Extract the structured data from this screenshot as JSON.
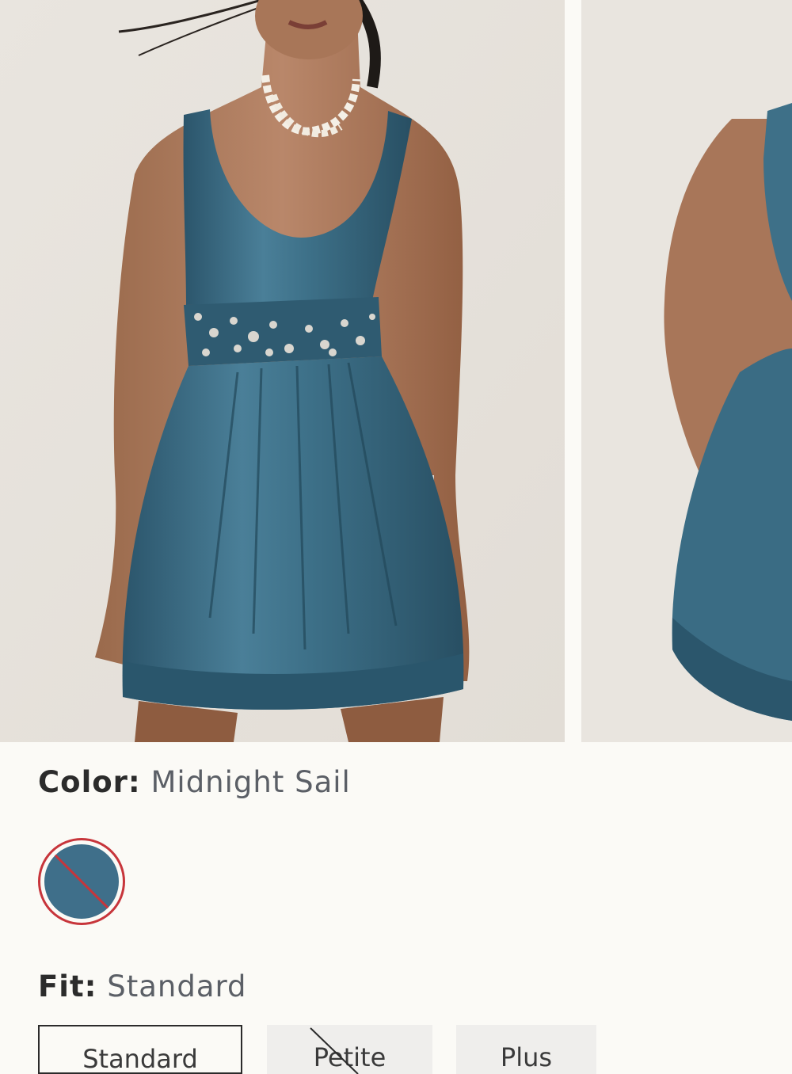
{
  "gallery": {
    "images": [
      {
        "alt": "Model wearing blue satin mini dress with embellished waistband, front view"
      },
      {
        "alt": "Model wearing blue satin mini dress, back view"
      }
    ]
  },
  "color": {
    "label": "Color:",
    "value": "Midnight Sail",
    "swatch_hex": "#3f6f8a",
    "swatch_unavailable": true,
    "unavailable_mark_color": "#c7353b"
  },
  "fit": {
    "label": "Fit:",
    "value": "Standard",
    "options": [
      {
        "label": "Standard",
        "selected": true,
        "available": true
      },
      {
        "label": "Petite",
        "selected": false,
        "available": false
      },
      {
        "label": "Plus",
        "selected": false,
        "available": true
      }
    ]
  }
}
